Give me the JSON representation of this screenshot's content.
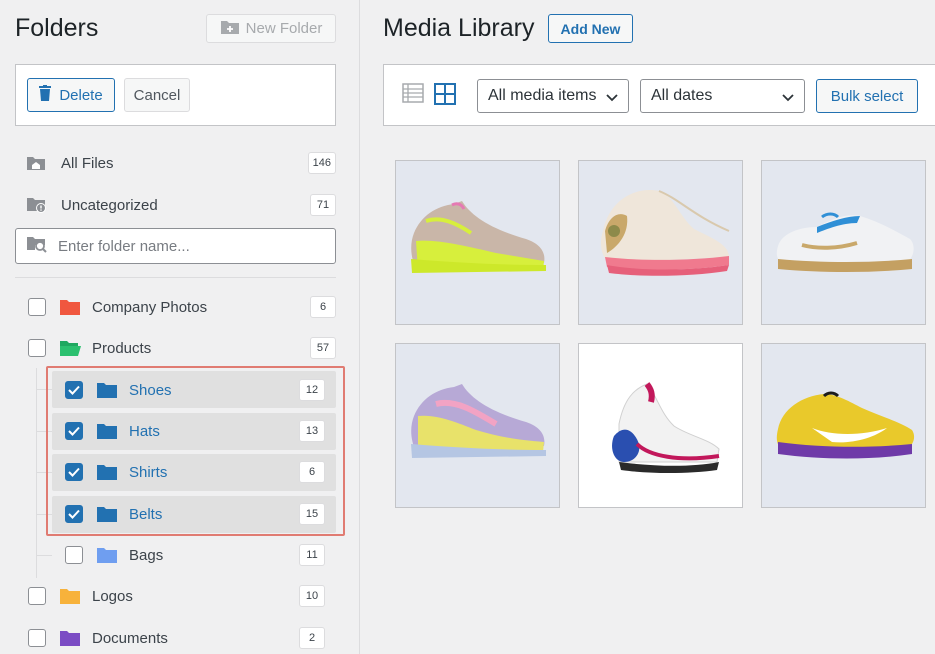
{
  "sidebar": {
    "title": "Folders",
    "new_folder_label": "New Folder",
    "delete_label": "Delete",
    "cancel_label": "Cancel",
    "all_files": {
      "label": "All Files",
      "count": "146"
    },
    "uncategorized": {
      "label": "Uncategorized",
      "count": "71"
    },
    "search_placeholder": "Enter folder name...",
    "folders": [
      {
        "label": "Company Photos",
        "count": "6",
        "color": "#f0573f",
        "checked": false
      },
      {
        "label": "Products",
        "count": "57",
        "color": "#1fa860",
        "checked": false
      },
      {
        "label": "Shoes",
        "count": "12",
        "color": "#2271b1",
        "checked": true
      },
      {
        "label": "Hats",
        "count": "13",
        "color": "#2271b1",
        "checked": true
      },
      {
        "label": "Shirts",
        "count": "6",
        "color": "#2271b1",
        "checked": true
      },
      {
        "label": "Belts",
        "count": "15",
        "color": "#2271b1",
        "checked": true
      },
      {
        "label": "Bags",
        "count": "11",
        "color": "#6f9ef0",
        "checked": false
      },
      {
        "label": "Logos",
        "count": "10",
        "color": "#f7b23b",
        "checked": false
      },
      {
        "label": "Documents",
        "count": "2",
        "color": "#7b4cc4",
        "checked": false
      }
    ]
  },
  "main": {
    "title": "Media Library",
    "add_new_label": "Add New",
    "filter_type": "All media items",
    "filter_date": "All dates",
    "bulk_select_label": "Bulk select",
    "items": [
      {
        "name": "neon-yellow-sneaker"
      },
      {
        "name": "cream-pink-sneaker"
      },
      {
        "name": "white-blue-training-shoe"
      },
      {
        "name": "pastel-gradient-sneaker"
      },
      {
        "name": "white-pink-chunky-sneaker"
      },
      {
        "name": "yellow-purple-sneaker"
      }
    ]
  },
  "colors": {
    "accent": "#2271b1",
    "highlight_outline": "#e07b72"
  }
}
